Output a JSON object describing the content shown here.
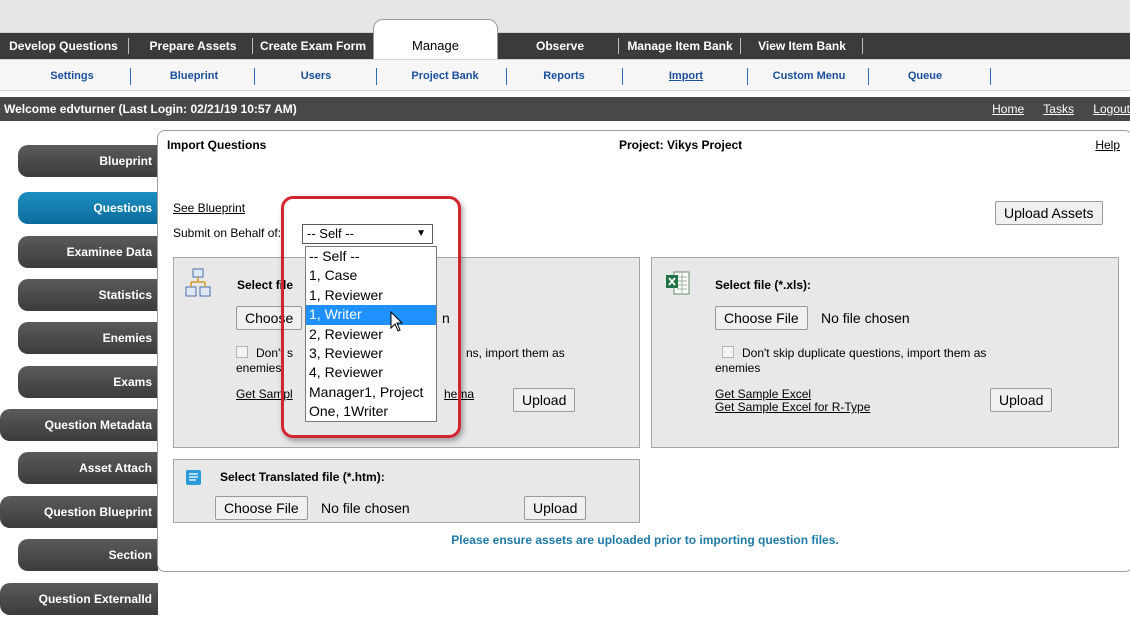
{
  "main_nav": [
    {
      "label": "Develop Questions"
    },
    {
      "label": "Prepare Assets"
    },
    {
      "label": "Create Exam Form"
    },
    {
      "label": "Manage",
      "active": true
    },
    {
      "label": "Observe"
    },
    {
      "label": "Manage Item Bank"
    },
    {
      "label": "View Item Bank"
    }
  ],
  "sub_nav": [
    {
      "label": "Settings"
    },
    {
      "label": "Blueprint"
    },
    {
      "label": "Users"
    },
    {
      "label": "Project Bank"
    },
    {
      "label": "Reports"
    },
    {
      "label": "Import",
      "current": true
    },
    {
      "label": "Custom Menu"
    },
    {
      "label": "Queue"
    }
  ],
  "welcome": {
    "text": "Welcome edvturner (Last Login: 02/21/19   10:57 AM)",
    "links": [
      "Home",
      "Tasks",
      "Logout"
    ]
  },
  "sidebar": [
    {
      "label": "Blueprint"
    },
    {
      "label": "Questions",
      "active": true
    },
    {
      "label": "Examinee Data"
    },
    {
      "label": "Statistics"
    },
    {
      "label": "Enemies"
    },
    {
      "label": "Exams"
    },
    {
      "label": "Question Metadata"
    },
    {
      "label": "Asset Attach"
    },
    {
      "label": "Question Blueprint"
    },
    {
      "label": "Section"
    },
    {
      "label": "Question ExternalId"
    }
  ],
  "panel": {
    "title": "Import Questions",
    "project": "Project: Vikys Project",
    "help": "Help",
    "see_blueprint": "See Blueprint",
    "submit_label": "Submit on Behalf of:",
    "submit_value": "-- Self --",
    "upload_assets": "Upload Assets",
    "dropdown_options": [
      "-- Self --",
      "1, Case",
      "1, Reviewer",
      "1, Writer",
      "2, Reviewer",
      "3, Reviewer",
      "4, Reviewer",
      "Manager1, Project",
      "One, 1Writer"
    ],
    "dropdown_selected": "1, Writer",
    "box_htm": {
      "select_label": "Select file",
      "choose": "Choose",
      "chosen_tail": "n",
      "skip_part": "Don't s",
      "skip_mid": "ns, import them as",
      "skip_end": "enemies",
      "sample_part": "Get Sampl",
      "sample_tail": "hema",
      "upload": "Upload"
    },
    "box_xls": {
      "select_label": "Select file (*.xls):",
      "choose": "Choose File",
      "chosen": "No file chosen",
      "skip": "Don't skip duplicate questions, import them as",
      "skip_end": "enemies",
      "sample1": "Get Sample Excel",
      "sample2": "Get Sample Excel for R-Type",
      "upload": "Upload"
    },
    "box_translated": {
      "select_label": "Select Translated file (*.htm):",
      "choose": "Choose File",
      "chosen": "No file chosen",
      "upload": "Upload"
    },
    "note": "Please ensure assets are uploaded prior to importing question files."
  },
  "colors": {
    "accent_red": "#d3242f",
    "nav_dark": "#3b3b3b",
    "link_blue": "#1b4f9c",
    "active_blue": "#0c6c9c"
  }
}
